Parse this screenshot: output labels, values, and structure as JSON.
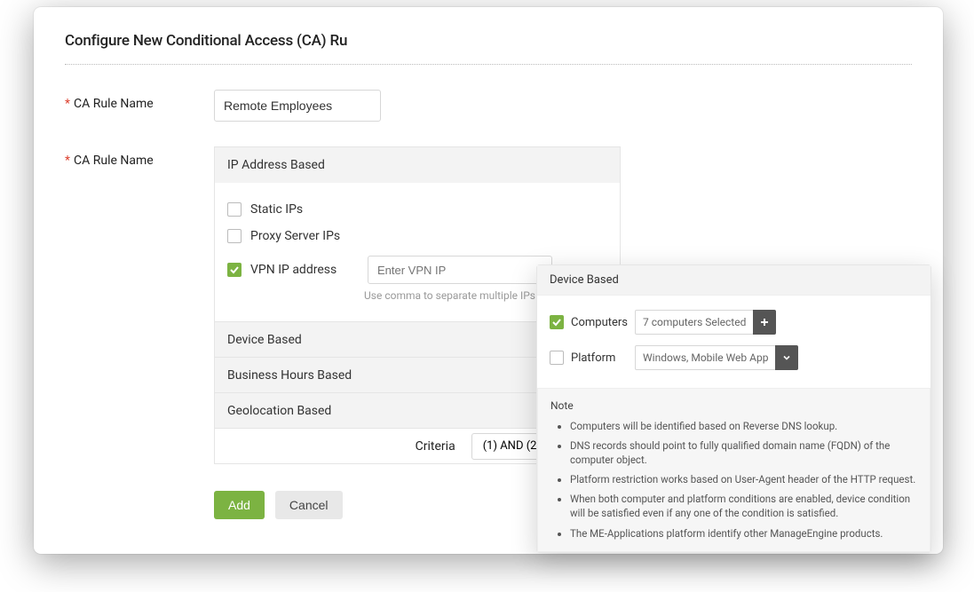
{
  "header": {
    "title": "Configure New Conditional Access (CA) Ru"
  },
  "labels": {
    "ca_rule_name_1": "CA Rule Name",
    "ca_rule_name_2": "CA Rule Name",
    "criteria": "Criteria"
  },
  "inputs": {
    "rule_name_value": "Remote Employees",
    "vpn_placeholder": "Enter VPN IP",
    "vpn_hint": "Use comma to separate multiple IPs",
    "criteria_value": "(1) AND (2)"
  },
  "sections": {
    "ip_based": "IP Address Based",
    "device_based": "Device Based",
    "hours_based": "Business Hours Based",
    "geo_based": "Geolocation Based"
  },
  "ip_options": {
    "static": "Static IPs",
    "proxy": "Proxy Server IPs",
    "vpn": "VPN IP address"
  },
  "buttons": {
    "add": "Add",
    "cancel": "Cancel"
  },
  "popover": {
    "title": "Device Based",
    "computers": "Computers",
    "computers_selected": "7 computers Selected",
    "platform": "Platform",
    "platform_value": "Windows, Mobile Web App",
    "note_label": "Note",
    "notes": [
      "Computers will be identified based on Reverse DNS lookup.",
      "DNS records should point to fully qualified domain name (FQDN) of the computer object.",
      "Platform restriction works based on User-Agent header of the HTTP request.",
      "When both computer and platform conditions are enabled, device condition will be satisfied even if any one of the condition is satisfied.",
      "The ME-Applications platform identify other ManageEngine products."
    ]
  }
}
